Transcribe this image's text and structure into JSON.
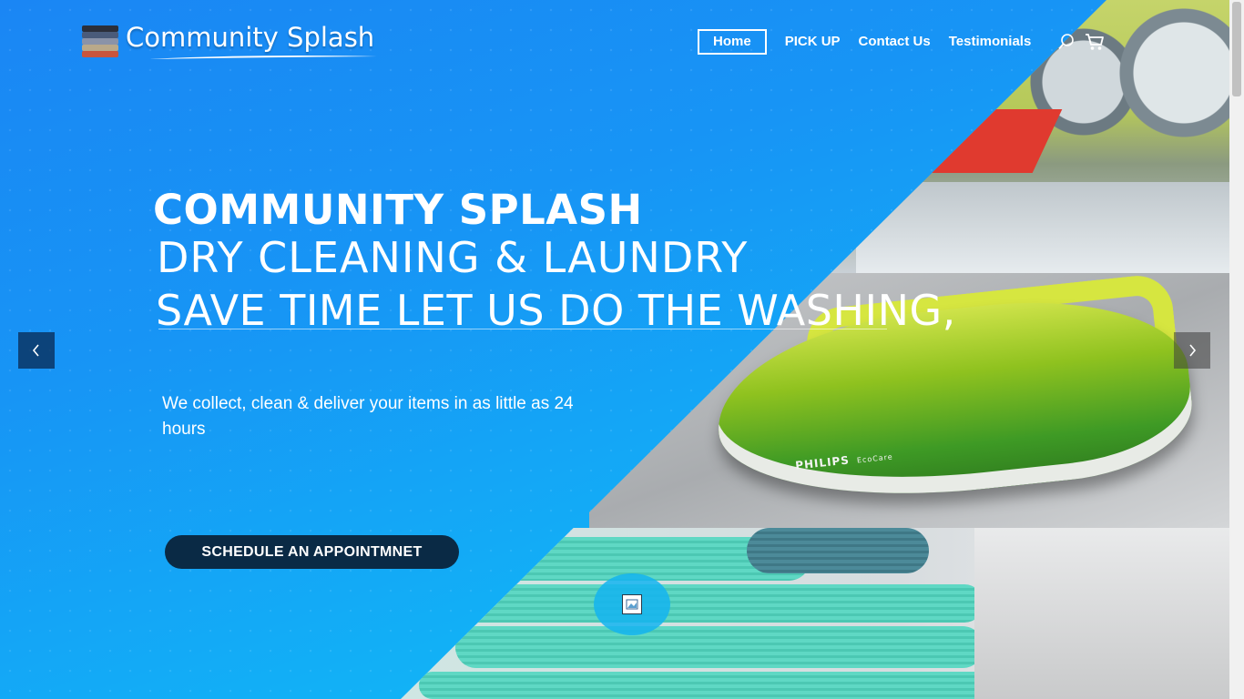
{
  "header": {
    "logo_text": "Community Splash",
    "nav": [
      {
        "label": "Home",
        "active": true
      },
      {
        "label": "PICK UP",
        "active": false
      },
      {
        "label": "Contact Us",
        "active": false
      },
      {
        "label": "Testimonials",
        "active": false
      }
    ],
    "icons": [
      "search-icon",
      "cart-icon"
    ]
  },
  "hero": {
    "title": "COMMUNITY SPLASH",
    "subtitle_1": "DRY CLEANING & LAUNDRY",
    "subtitle_2": "SAVE TIME LET US DO THE WASHING,",
    "description": "We collect, clean & deliver your items in as little as 24 hours",
    "cta_label": "SCHEDULE AN APPOINTMNET"
  },
  "photos": {
    "iron_brand": "PHILIPS",
    "iron_model": "EcoCare"
  },
  "carousel": {
    "prev_icon": "chevron-left-icon",
    "next_icon": "chevron-right-icon"
  },
  "colors": {
    "background_start": "#1a86f4",
    "background_end": "#0fc2f6",
    "cta_background": "#0a2a45",
    "text": "#ffffff"
  }
}
